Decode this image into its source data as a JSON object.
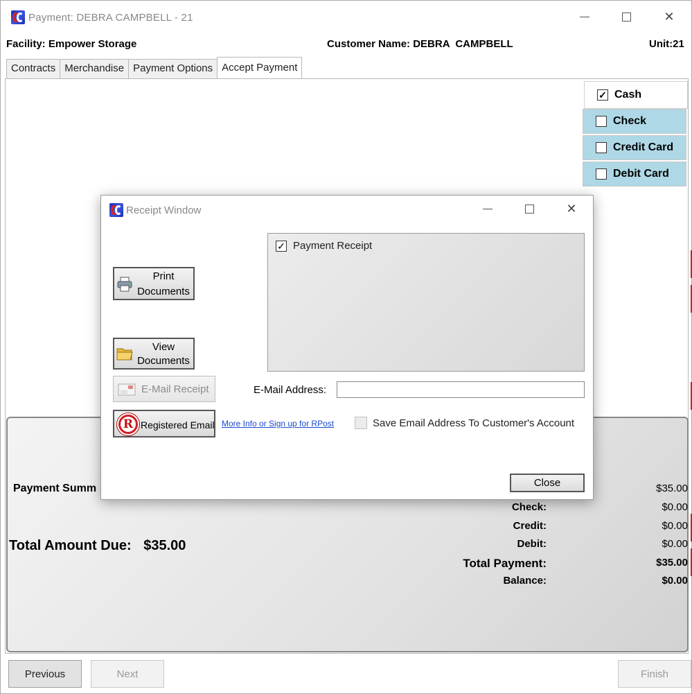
{
  "window": {
    "title": "Payment: DEBRA  CAMPBELL - 21",
    "facility_label": "Facility:",
    "facility_value": "Empower Storage",
    "customer_label": "Customer Name:",
    "customer_value": "DEBRA  CAMPBELL",
    "unit_label": "Unit:",
    "unit_value": "21",
    "minimize_glyph": "—",
    "close_glyph": "✕"
  },
  "tabs": [
    {
      "label": "Contracts"
    },
    {
      "label": "Merchandise"
    },
    {
      "label": "Payment Options"
    },
    {
      "label": "Accept Payment",
      "active": true
    }
  ],
  "payment_methods": [
    {
      "label": "Cash",
      "checked": true
    },
    {
      "label": "Check",
      "checked": false
    },
    {
      "label": "Credit Card",
      "checked": false
    },
    {
      "label": "Debit Card",
      "checked": false
    }
  ],
  "summary": {
    "heading": "Payment Summ",
    "total_due_label": "Total Amount Due:",
    "total_due_value": "$35.00",
    "rows": [
      {
        "label": "",
        "value": "$35.00"
      },
      {
        "label": "Check:",
        "value": "$0.00"
      },
      {
        "label": "Credit:",
        "value": "$0.00"
      },
      {
        "label": "Debit:",
        "value": "$0.00"
      },
      {
        "label": "Total Payment:",
        "value": "$35.00"
      },
      {
        "label": "Balance:",
        "value": "$0.00"
      }
    ]
  },
  "nav": {
    "previous": "Previous",
    "next": "Next",
    "finish": "Finish"
  },
  "receipt_window": {
    "title": "Receipt Window",
    "print_line1": "Print",
    "print_line2": "Documents",
    "view_line1": "View",
    "view_line2": "Documents",
    "email_receipt": "E-Mail Receipt",
    "registered_email": "Registered Email",
    "rpost_link": "More Info or Sign up for RPost",
    "email_label": "E-Mail Address:",
    "email_value": "",
    "save_email_label": "Save Email Address To Customer's Account",
    "documents": [
      {
        "label": "Payment Receipt",
        "checked": true
      }
    ],
    "close": "Close",
    "minimize_glyph": "—",
    "close_glyph": "✕"
  },
  "colors": {
    "payment_option_bg": "#aed8e6",
    "link": "#1a4ad0",
    "status_red": "#c82020"
  }
}
